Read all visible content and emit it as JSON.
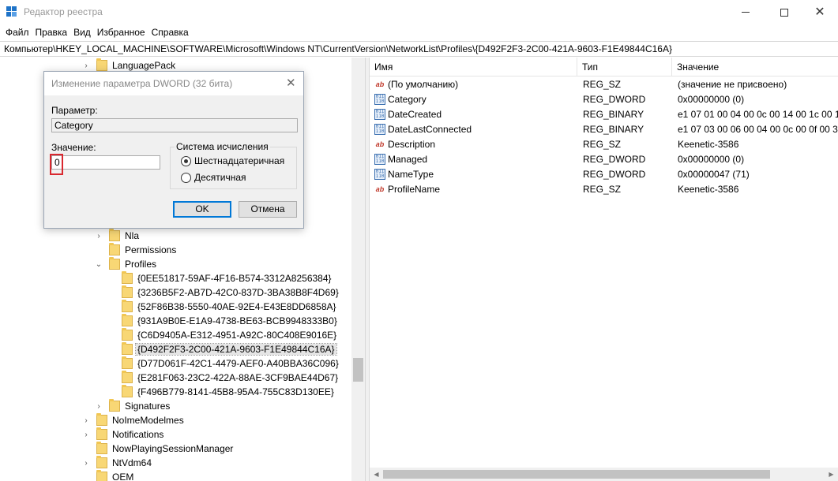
{
  "window": {
    "title": "Редактор реестра"
  },
  "menu": [
    "Файл",
    "Правка",
    "Вид",
    "Избранное",
    "Справка"
  ],
  "address": "Компьютер\\HKEY_LOCAL_MACHINE\\SOFTWARE\\Microsoft\\Windows NT\\CurrentVersion\\NetworkList\\Profiles\\{D492F2F3-2C00-421A-9603-F1E49844C16A}",
  "tree": {
    "languagepack": "LanguagePack",
    "nla": "Nla",
    "permissions": "Permissions",
    "profiles": "Profiles",
    "profile_keys": [
      "{0EE51817-59AF-4F16-B574-3312A8256384}",
      "{3236B5F2-AB7D-42C0-837D-3BA38B8F4D69}",
      "{52F86B38-5550-40AE-92E4-E43E8DD6858A}",
      "{931A9B0E-E1A9-4738-BE63-BCB9948333B0}",
      "{C6D9405A-E312-4951-A92C-80C408E9016E}",
      "{D492F2F3-2C00-421A-9603-F1E49844C16A}",
      "{D77D061F-42C1-4479-AEF0-A40BBA36C096}",
      "{E281F063-23C2-422A-88AE-3CF9BAE44D67}",
      "{F496B779-8141-45B8-95A4-755C83D130EE}"
    ],
    "signatures": "Signatures",
    "nolmemodelmes": "NoImeModelmes",
    "notifications": "Notifications",
    "nowplaying": "NowPlayingSessionManager",
    "ntvdm64": "NtVdm64",
    "oem": "OEM"
  },
  "list": {
    "headers": {
      "name": "Имя",
      "type": "Тип",
      "value": "Значение"
    },
    "rows": [
      {
        "icon": "ab",
        "name": "(По умолчанию)",
        "type": "REG_SZ",
        "value": "(значение не присвоено)"
      },
      {
        "icon": "bin",
        "name": "Category",
        "type": "REG_DWORD",
        "value": "0x00000000 (0)"
      },
      {
        "icon": "bin",
        "name": "DateCreated",
        "type": "REG_BINARY",
        "value": "e1 07 01 00 04 00 0c 00 14 00 1c 00 14 00"
      },
      {
        "icon": "bin",
        "name": "DateLastConnected",
        "type": "REG_BINARY",
        "value": "e1 07 03 00 06 00 04 00 0c 00 0f 00 37 00"
      },
      {
        "icon": "ab",
        "name": "Description",
        "type": "REG_SZ",
        "value": "Keenetic-3586"
      },
      {
        "icon": "bin",
        "name": "Managed",
        "type": "REG_DWORD",
        "value": "0x00000000 (0)"
      },
      {
        "icon": "bin",
        "name": "NameType",
        "type": "REG_DWORD",
        "value": "0x00000047 (71)"
      },
      {
        "icon": "ab",
        "name": "ProfileName",
        "type": "REG_SZ",
        "value": "Keenetic-3586"
      }
    ]
  },
  "dialog": {
    "title": "Изменение параметра DWORD (32 бита)",
    "param_label": "Параметр:",
    "param_value": "Category",
    "value_label": "Значение:",
    "value": "0",
    "base_label": "Система исчисления",
    "radio_hex": "Шестнадцатеричная",
    "radio_dec": "Десятичная",
    "selected_base": "hex",
    "ok": "OK",
    "cancel": "Отмена"
  }
}
